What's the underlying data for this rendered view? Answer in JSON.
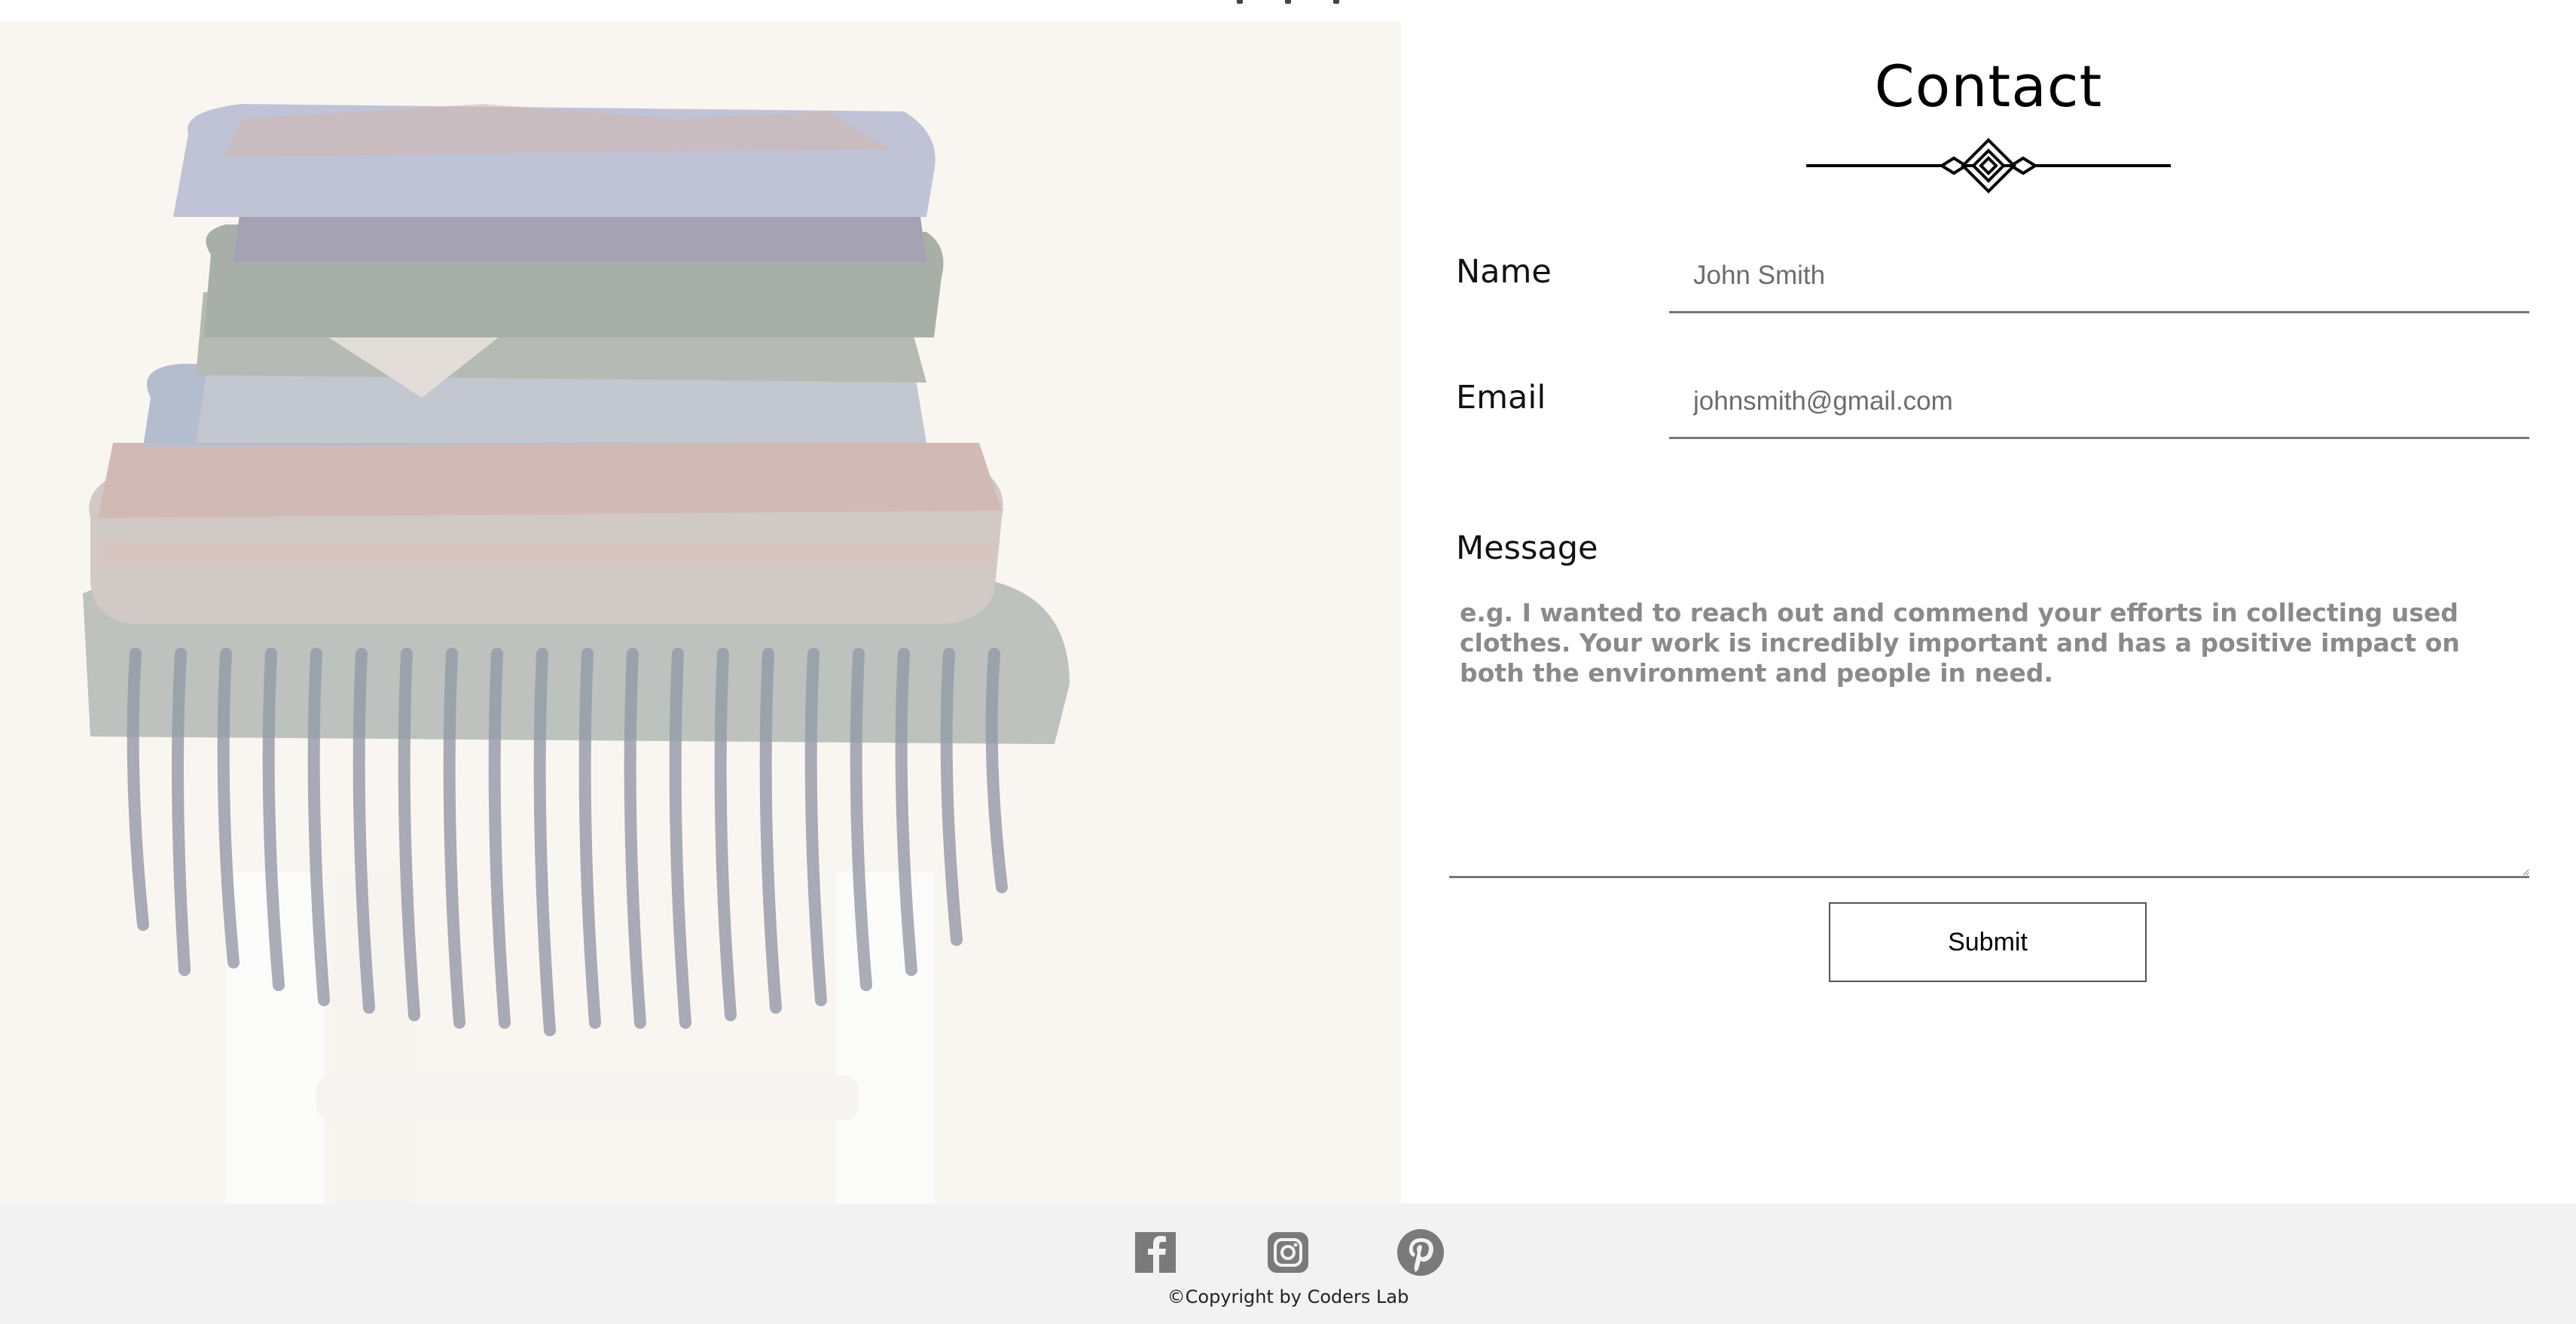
{
  "contact": {
    "title": "Contact",
    "name_label": "Name",
    "name_placeholder": "John Smith",
    "email_label": "Email",
    "email_placeholder": "johnsmith@gmail.com",
    "message_label": "Message",
    "message_placeholder": "e.g. I wanted to reach out and commend your efforts in collecting used clothes. Your work is incredibly important and has a positive impact on both the environment and people in need.",
    "submit_label": "Submit"
  },
  "footer": {
    "social_icons": [
      "facebook-icon",
      "instagram-icon",
      "pinterest-icon"
    ],
    "copyright": "©Copyright by Coders Lab"
  },
  "colors": {
    "underline": "#777777",
    "footer_bg": "#f1f2f1",
    "icon_gray": "#7a7a7a"
  }
}
